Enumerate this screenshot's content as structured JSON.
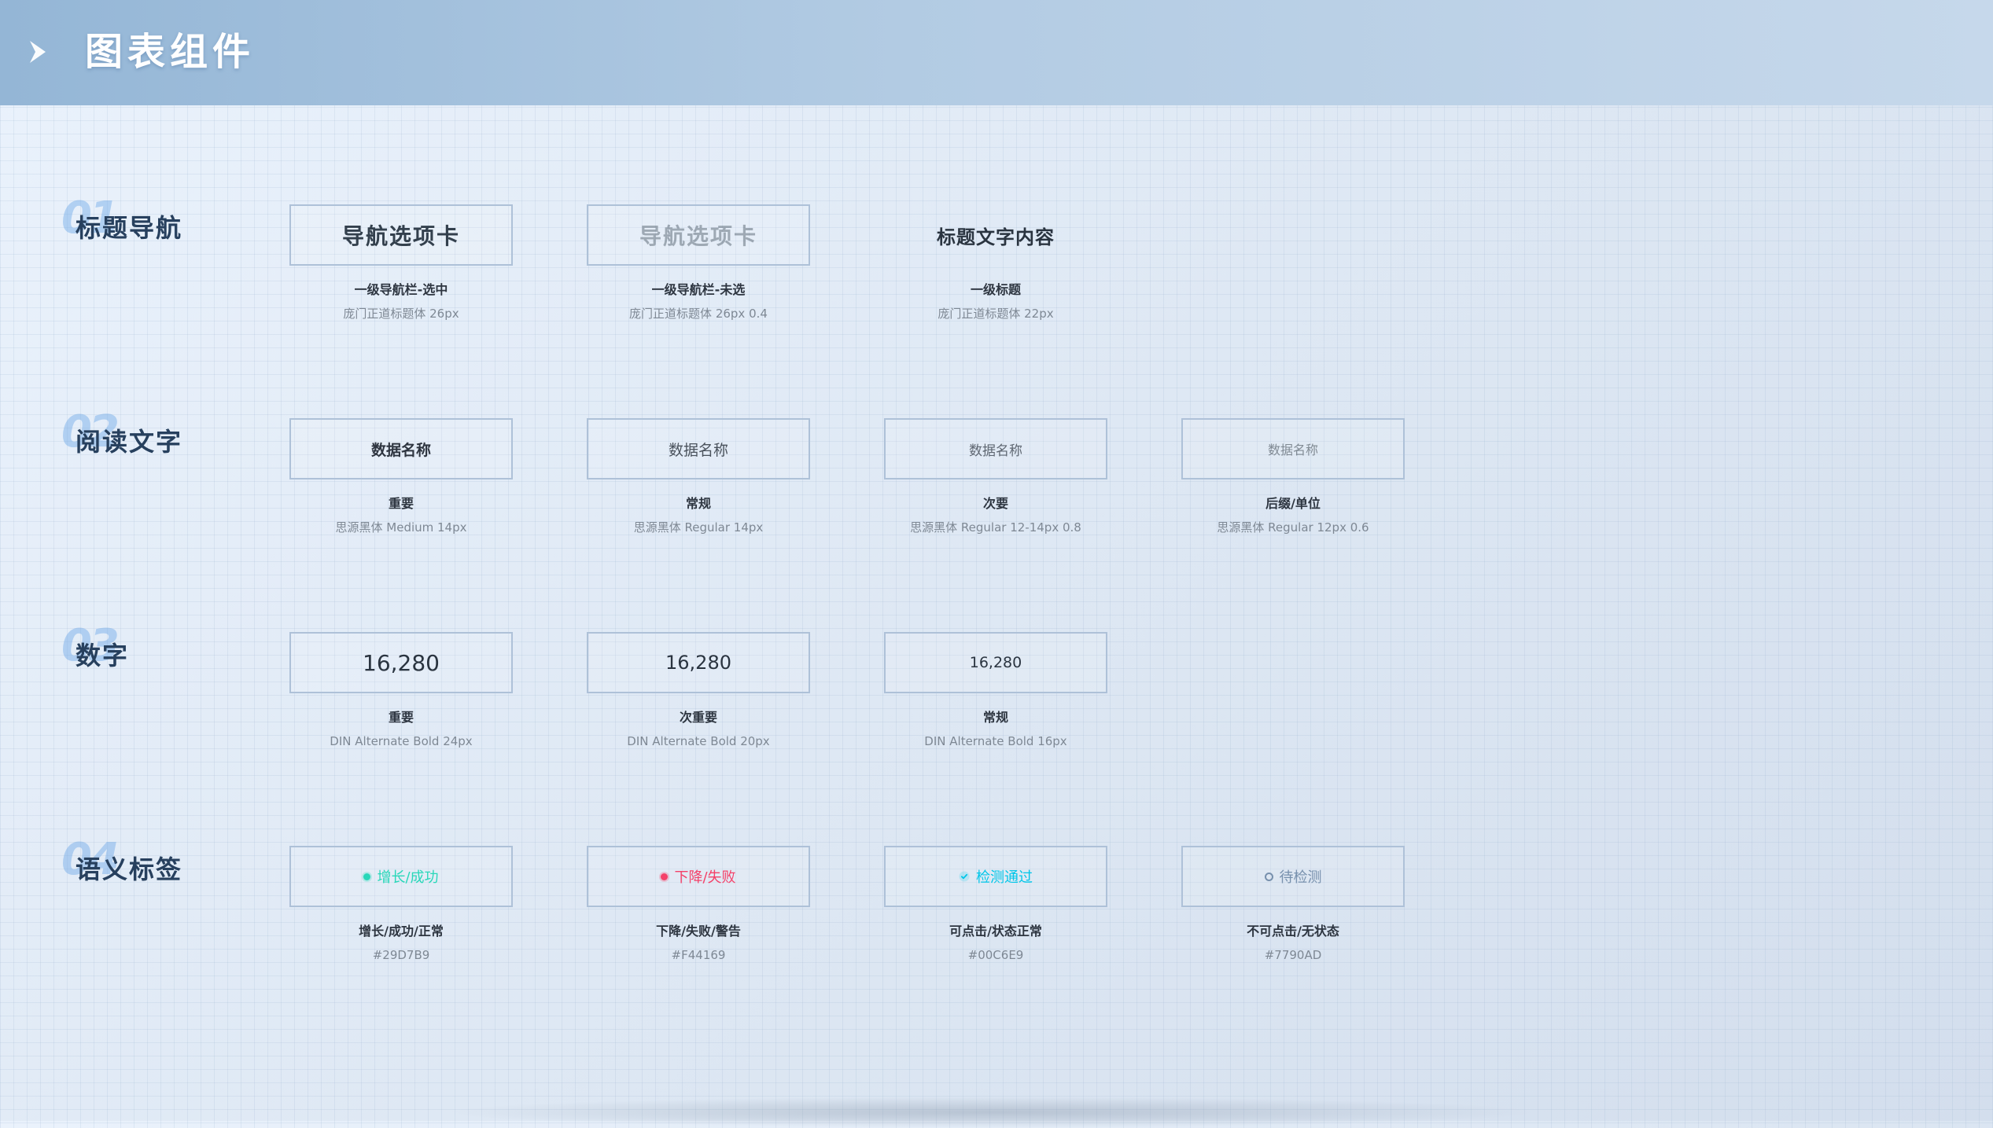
{
  "header": {
    "title": "图表组件"
  },
  "sections": [
    {
      "number": "01",
      "title": "标题导航",
      "cards": [
        {
          "sample": "导航选项卡",
          "caption": "一级导航栏-选中",
          "spec": "庞门正道标题体 26px"
        },
        {
          "sample": "导航选项卡",
          "caption": "一级导航栏-未选",
          "spec": "庞门正道标题体 26px 0.4"
        },
        {
          "sample": "标题文字内容",
          "caption": "一级标题",
          "spec": "庞门正道标题体 22px"
        }
      ]
    },
    {
      "number": "02",
      "title": "阅读文字",
      "cards": [
        {
          "sample": "数据名称",
          "caption": "重要",
          "spec": "思源黑体 Medium 14px"
        },
        {
          "sample": "数据名称",
          "caption": "常规",
          "spec": "思源黑体 Regular 14px"
        },
        {
          "sample": "数据名称",
          "caption": "次要",
          "spec": "思源黑体 Regular 12-14px 0.8"
        },
        {
          "sample": "数据名称",
          "caption": "后缀/单位",
          "spec": "思源黑体 Regular 12px 0.6"
        }
      ]
    },
    {
      "number": "03",
      "title": "数字",
      "cards": [
        {
          "sample": "16,280",
          "caption": "重要",
          "spec": "DIN Alternate Bold 24px"
        },
        {
          "sample": "16,280",
          "caption": "次重要",
          "spec": "DIN Alternate Bold 20px"
        },
        {
          "sample": "16,280",
          "caption": "常规",
          "spec": "DIN Alternate Bold 16px"
        }
      ]
    },
    {
      "number": "04",
      "title": "语义标签",
      "cards": [
        {
          "sample": "增长/成功",
          "caption": "增长/成功/正常",
          "spec": "#29D7B9",
          "color": "#29D7B9",
          "icon": "success-dot-icon"
        },
        {
          "sample": "下降/失败",
          "caption": "下降/失败/警告",
          "spec": "#F44169",
          "color": "#F44169",
          "icon": "error-dot-icon"
        },
        {
          "sample": "检测通过",
          "caption": "可点击/状态正常",
          "spec": "#00C6E9",
          "color": "#00C6E9",
          "icon": "check-icon"
        },
        {
          "sample": "待检测",
          "caption": "不可点击/无状态",
          "spec": "#7790AD",
          "color": "#7790AD",
          "icon": "pending-dot-icon"
        }
      ]
    }
  ]
}
